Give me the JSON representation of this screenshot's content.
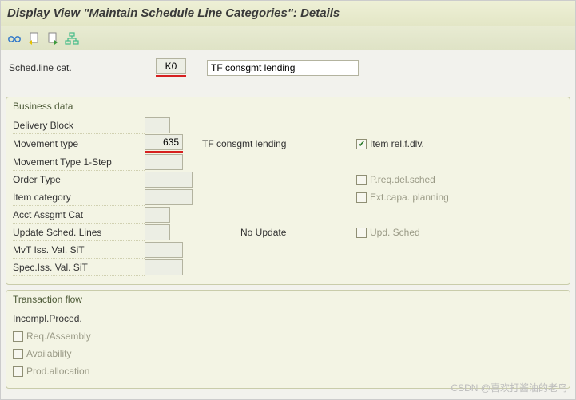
{
  "title": "Display View \"Maintain Schedule Line Categories\": Details",
  "toolbar": {
    "icons": [
      "glasses",
      "doc-prev",
      "doc-next",
      "hierarchy"
    ]
  },
  "header": {
    "label": "Sched.line cat.",
    "code": "K0",
    "desc": "TF consgmt lending"
  },
  "business": {
    "title": "Business data",
    "rows": {
      "delivery_block": {
        "label": "Delivery Block",
        "value": ""
      },
      "movement_type": {
        "label": "Movement type",
        "value": "635",
        "text": "TF consgmt lending"
      },
      "movement_type_1s": {
        "label": "Movement Type 1-Step",
        "value": ""
      },
      "order_type": {
        "label": "Order Type",
        "value": ""
      },
      "item_category": {
        "label": "Item category",
        "value": ""
      },
      "acct_assgmt": {
        "label": "Acct Assgmt Cat",
        "value": ""
      },
      "update_sched": {
        "label": "Update Sched. Lines",
        "value": "",
        "text": "No Update"
      },
      "mvt_iss": {
        "label": "MvT Iss. Val. SiT",
        "value": ""
      },
      "spec_iss": {
        "label": "Spec.Iss. Val. SiT",
        "value": ""
      }
    },
    "checks": {
      "item_rel": {
        "label": "Item rel.f.dlv.",
        "checked": true
      },
      "preq": {
        "label": "P.req.del.sched",
        "checked": false
      },
      "extcapa": {
        "label": "Ext.capa. planning",
        "checked": false
      },
      "upd_sched": {
        "label": "Upd. Sched",
        "checked": false
      }
    }
  },
  "trans": {
    "title": "Transaction flow",
    "incompl_label": "Incompl.Proced.",
    "checks": {
      "req_asm": {
        "label": "Req./Assembly",
        "checked": false
      },
      "avail": {
        "label": "Availability",
        "checked": false
      },
      "prod": {
        "label": "Prod.allocation",
        "checked": false
      }
    }
  },
  "watermark": "CSDN @喜欢打酱油的老鸟"
}
